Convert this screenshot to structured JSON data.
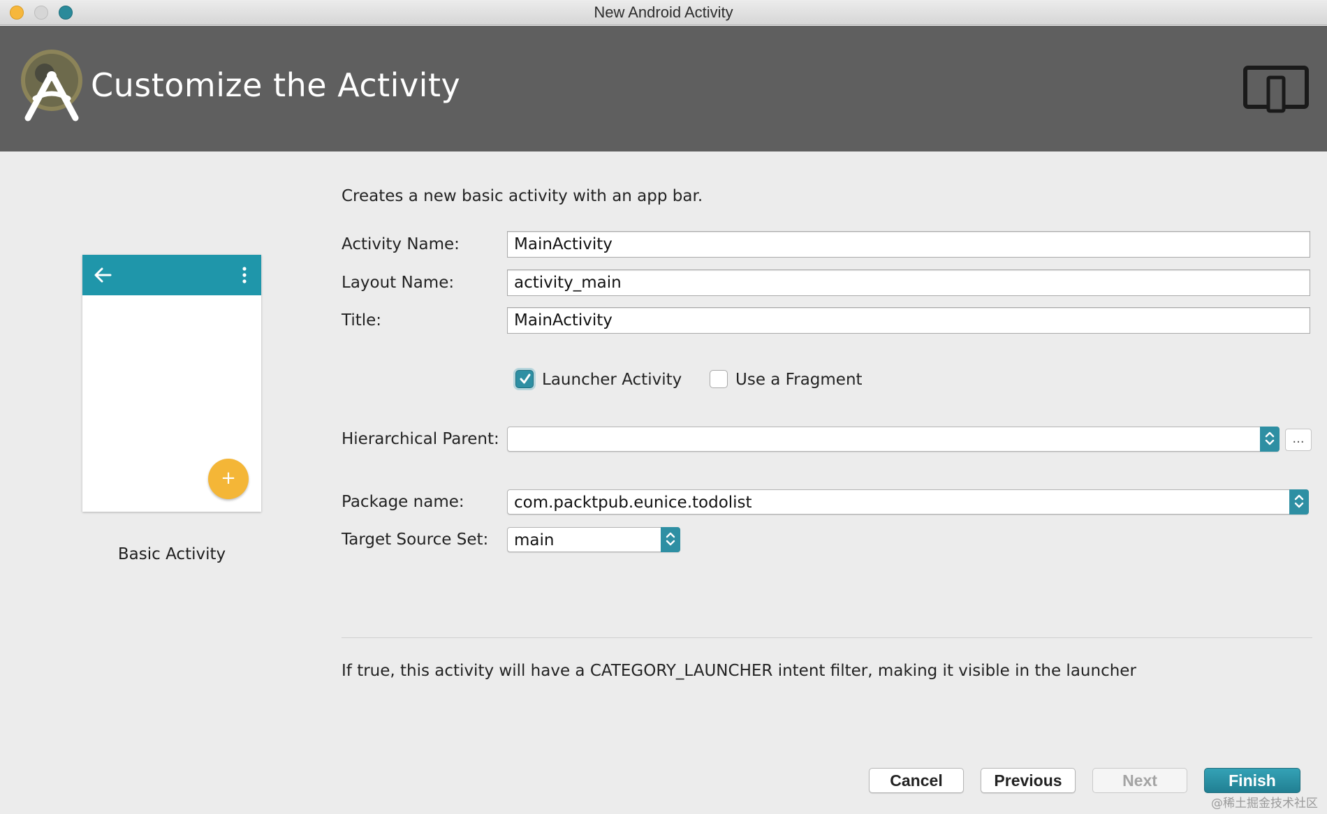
{
  "window": {
    "title": "New Android Activity"
  },
  "header": {
    "title": "Customize the Activity"
  },
  "preview": {
    "label": "Basic Activity",
    "fab_symbol": "+"
  },
  "form": {
    "description": "Creates a new basic activity with an app bar.",
    "activity_name": {
      "label": "Activity Name:",
      "value": "MainActivity"
    },
    "layout_name": {
      "label": "Layout Name:",
      "value": "activity_main"
    },
    "title": {
      "label": "Title:",
      "value": "MainActivity"
    },
    "launcher_activity": {
      "label": "Launcher Activity",
      "checked": true
    },
    "use_fragment": {
      "label": "Use a Fragment",
      "checked": false
    },
    "hierarchical_parent": {
      "label": "Hierarchical Parent:",
      "value": "",
      "browse_label": "..."
    },
    "package_name": {
      "label": "Package name:",
      "value": "com.packtpub.eunice.todolist"
    },
    "target_source_set": {
      "label": "Target Source Set:",
      "value": "main"
    },
    "help_text": "If true, this activity will have a CATEGORY_LAUNCHER intent filter, making it visible in the launcher"
  },
  "buttons": {
    "cancel": "Cancel",
    "previous": "Previous",
    "next": "Next",
    "finish": "Finish"
  },
  "watermark": "@稀土掘金技术社区",
  "colors": {
    "accent": "#2e8fa3",
    "header_bg": "#5f5f5f",
    "app_bar": "#1f96aa",
    "fab": "#f4b637",
    "close_button": "#f6b73c"
  },
  "icons": {
    "logo": "android-studio-logo-icon",
    "device": "device-form-factor-icon",
    "back": "arrow-back-icon",
    "menu": "overflow-menu-icon"
  }
}
